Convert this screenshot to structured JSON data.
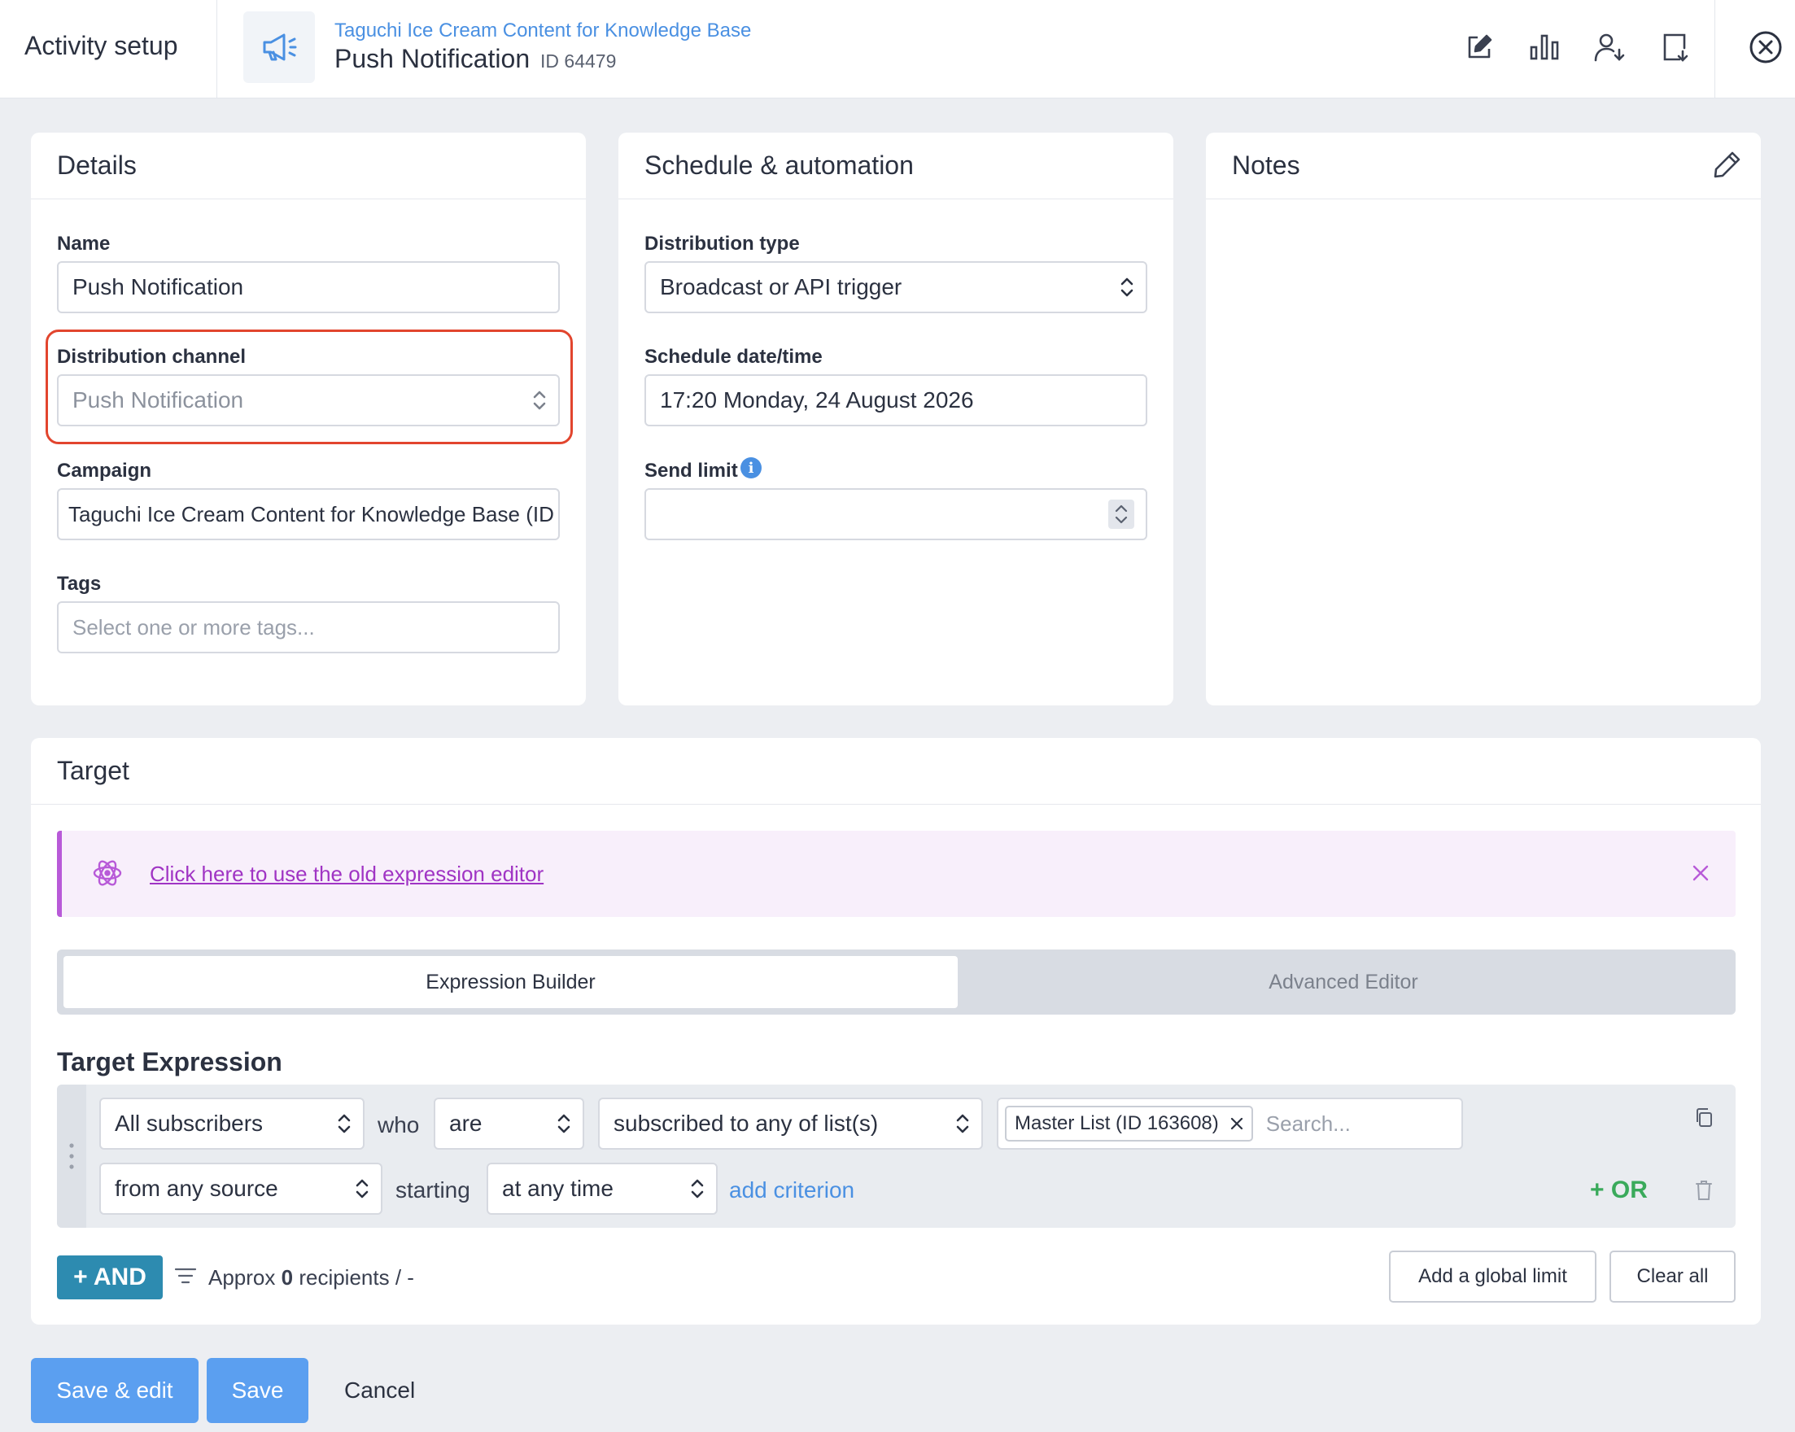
{
  "header": {
    "title": "Activity setup",
    "campaign_link": "Taguchi Ice Cream Content for Knowledge Base",
    "activity_name": "Push Notification",
    "activity_id": "ID 64479",
    "actions": [
      "edit-icon",
      "stats-icon",
      "subscriber-import-icon",
      "export-icon",
      "close-icon"
    ]
  },
  "details": {
    "heading": "Details",
    "name_label": "Name",
    "name_value": "Push Notification",
    "channel_label": "Distribution channel",
    "channel_value": "Push Notification",
    "campaign_label": "Campaign",
    "campaign_value": "Taguchi Ice Cream Content for Knowledge Base (ID",
    "tags_label": "Tags",
    "tags_placeholder": "Select one or more tags..."
  },
  "schedule": {
    "heading": "Schedule & automation",
    "dist_type_label": "Distribution type",
    "dist_type_value": "Broadcast or API trigger",
    "datetime_label": "Schedule date/time",
    "datetime_value": "17:20 Monday, 24 August 2026",
    "send_limit_label": "Send limit",
    "send_limit_value": ""
  },
  "notes": {
    "heading": "Notes"
  },
  "target": {
    "heading": "Target",
    "banner_link": "Click here to use the old expression editor",
    "tabs": [
      "Expression Builder",
      "Advanced Editor"
    ],
    "expression_title": "Target Expression",
    "row1": {
      "subject": "All subscribers",
      "who": "who",
      "verb": "are",
      "condition": "subscribed to any of list(s)",
      "chip": "Master List (ID 163608)",
      "search_placeholder": "Search..."
    },
    "row2": {
      "source": "from any source",
      "starting": "starting",
      "time": "at any time",
      "add_criterion": "add criterion",
      "or": "+ OR"
    },
    "and_button": "+ AND",
    "approx_prefix": "Approx",
    "approx_count": "0",
    "approx_suffix": "recipients / -",
    "global_limit": "Add a global limit",
    "clear_all": "Clear all"
  },
  "footer": {
    "save_edit": "Save & edit",
    "save": "Save",
    "cancel": "Cancel"
  },
  "colors": {
    "accent": "#4a90e2",
    "primary_button": "#5b9ff0",
    "highlight": "#e2452e",
    "and_button": "#2d8bb0",
    "or_text": "#3aaa5b",
    "banner": "#b85ad8"
  }
}
